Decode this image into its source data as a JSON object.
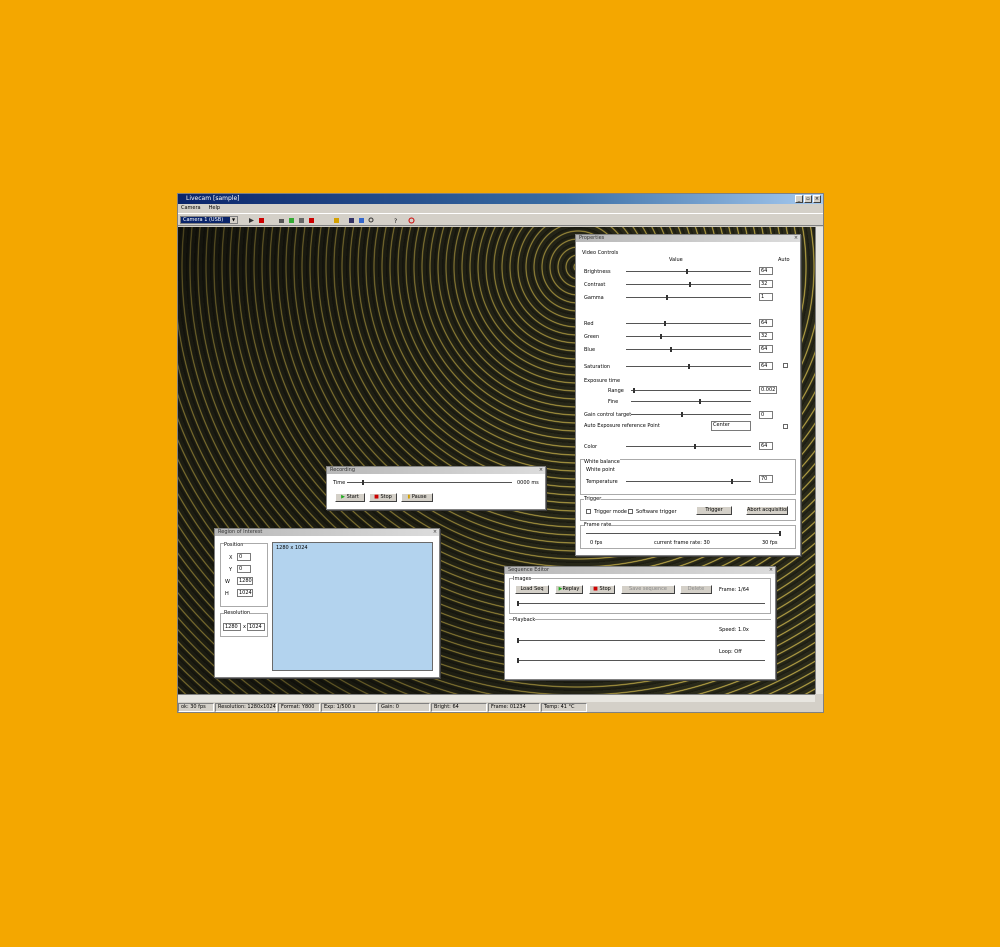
{
  "app": {
    "title": "Livecam [sample]"
  },
  "menu": [
    "Camera",
    "Help"
  ],
  "toolbar": {
    "combo_value": "Camera 1 (USB)"
  },
  "status": [
    "ok: 30 fps",
    "Resolution: 1280x1024",
    "Format: Y800",
    "Exp: 1/500 s",
    "Gain: 0",
    "Bright: 64",
    "Frame: 01234",
    "Temp: 41 °C"
  ],
  "props": {
    "title": "Properties",
    "section": "Video Controls",
    "colhead_auto": "Auto",
    "colhead_value": "Value",
    "rows": [
      {
        "label": "Brightness",
        "value": "64"
      },
      {
        "label": "Contrast",
        "value": "32"
      },
      {
        "label": "Gamma",
        "value": "1"
      },
      {
        "label": "Red",
        "value": "64"
      },
      {
        "label": "Green",
        "value": "32"
      },
      {
        "label": "Blue",
        "value": "64"
      },
      {
        "label": "Saturation",
        "value": "64"
      }
    ],
    "exposure_label": "Exposure time",
    "range_label": "Range",
    "fine_label": "Fine",
    "exposure_value": "0.002",
    "gain_label": "Gain control target",
    "gain_value": "0",
    "auto_ref_label": "Auto Exposure reference Point",
    "auto_ref_value": "Center",
    "color_label": "Color",
    "color_value": "64",
    "wb_title": "White balance",
    "wb_sub": "White point",
    "wb_label": "Temperature",
    "wb_value": "70",
    "trig_title": "Trigger",
    "trig_chk1": "Trigger mode",
    "trig_chk2": "Software trigger",
    "trig_btn1": "Trigger",
    "trig_btn2": "Abort acquisition",
    "fps_title": "Frame rate",
    "fps_left": "0 fps",
    "fps_mid": "current frame rate: 30",
    "fps_right": "30 fps"
  },
  "recorder": {
    "title": "Recording",
    "time_label": "Time",
    "time_value": "0000 ms",
    "btn_start": "Start",
    "btn_stop": "Stop",
    "btn_pause": "Pause"
  },
  "roi": {
    "title": "Region of Interest",
    "group1": "Position",
    "labels": [
      "X",
      "Y",
      "W",
      "H"
    ],
    "values": [
      "0",
      "0",
      "1280",
      "1024"
    ],
    "group2": "Resolution",
    "res_w": "1280",
    "res_sep": "x",
    "res_h": "1024",
    "preview_label": "1280 x 1024"
  },
  "seq": {
    "title": "Sequence Editor",
    "group1": "Images",
    "btns": [
      "Load Seq",
      "Replay",
      "Stop",
      "Save sequence",
      "Delete"
    ],
    "frames": "Frame: 1/64",
    "group2": "Playback",
    "speed": "Speed: 1.0x",
    "loop": "Loop: Off"
  },
  "colors": {
    "background": "#F4A700",
    "blue_panel": "#B3D3EE",
    "title_blue": "#0A246A"
  }
}
